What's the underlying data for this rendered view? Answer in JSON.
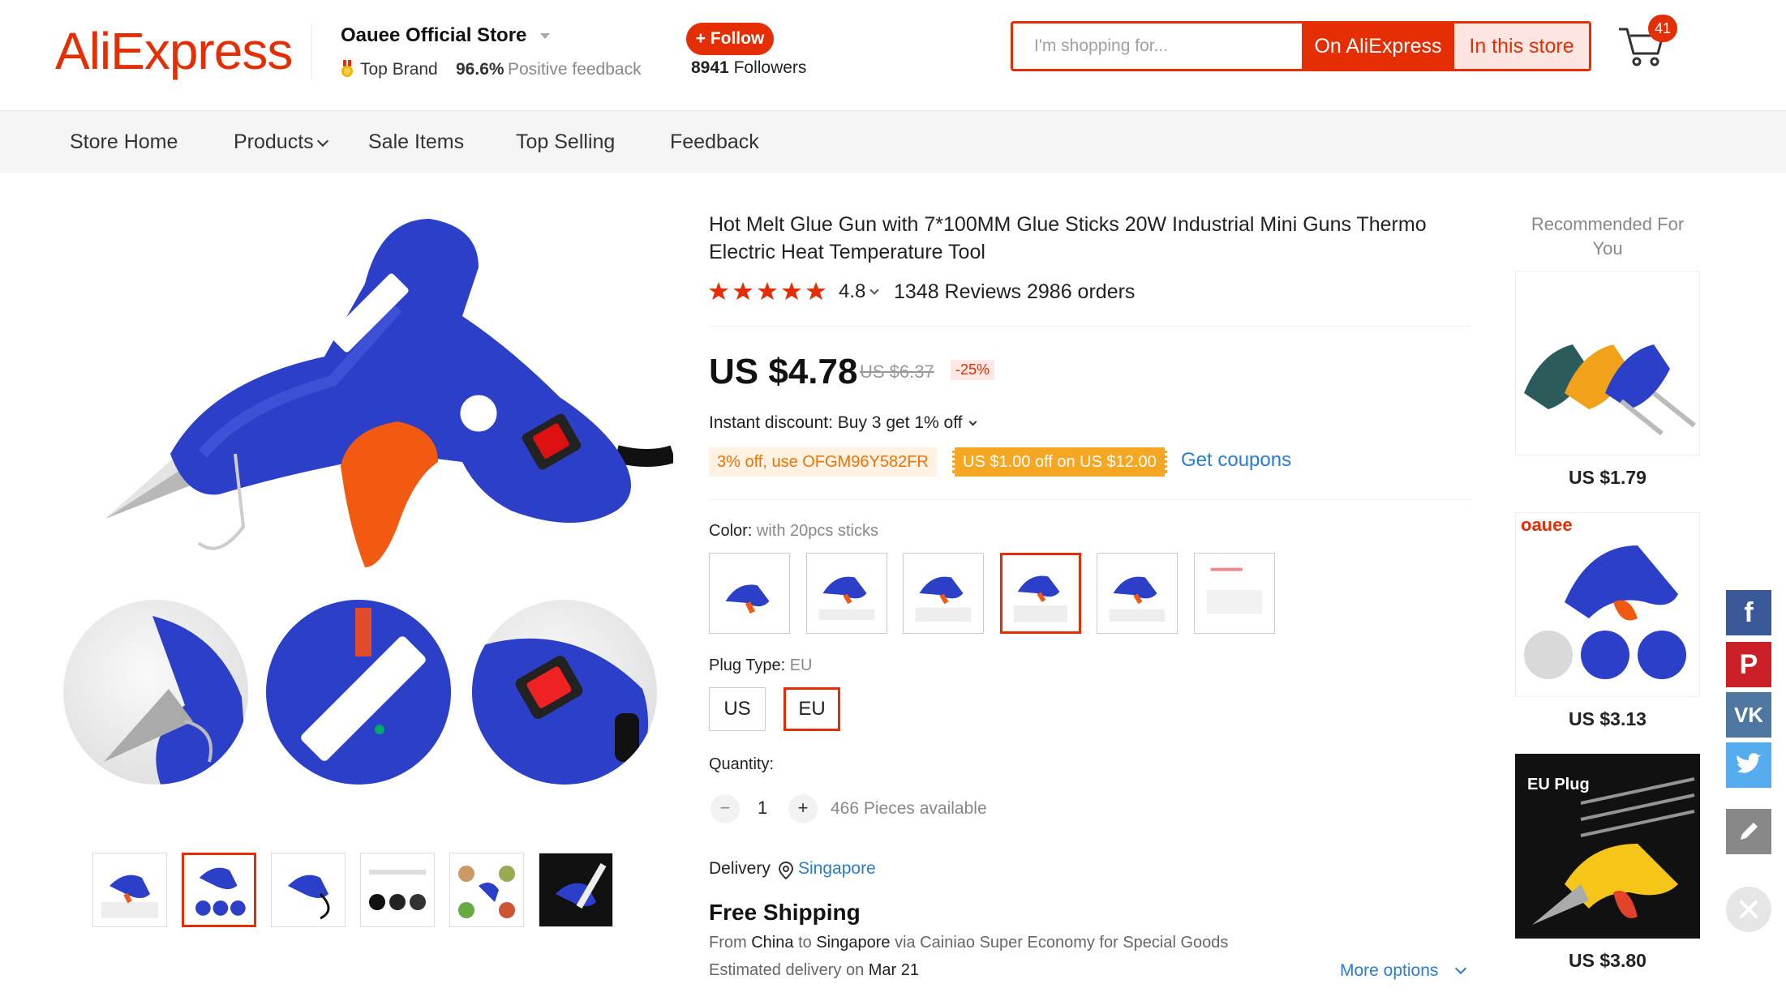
{
  "header": {
    "logo_text": "AliExpress",
    "store_name": "Oauee Official Store",
    "top_brand": "Top Brand",
    "positive_pct": "96.6%",
    "positive_label": "Positive feedback",
    "follow_label": "+ Follow",
    "followers_count": "8941",
    "followers_label": "Followers",
    "search_placeholder": "I'm shopping for...",
    "btn_on_aliexpress": "On AliExpress",
    "btn_in_store": "In this store",
    "cart_count": "41"
  },
  "nav": {
    "items": [
      "Store Home",
      "Products",
      "Sale Items",
      "Top Selling",
      "Feedback"
    ]
  },
  "product": {
    "title": "Hot Melt Glue Gun with 7*100MM Glue Sticks 20W Industrial Mini Guns Thermo Electric Heat Temperature Tool",
    "rating": "4.8",
    "reviews": "1348 Reviews",
    "orders": "2986 orders",
    "price": "US $4.78",
    "old_price": "US $6.37",
    "discount": "-25%",
    "instant_discount_label": "Instant discount:",
    "instant_discount_value": "Buy 3 get 1% off",
    "coupon_code": "3% off, use OFGM96Y582FR",
    "coupon_store": "US $1.00 off on US $12.00",
    "get_coupons": "Get coupons",
    "color_label": "Color:",
    "color_value": "with 20pcs sticks",
    "plug_label": "Plug Type:",
    "plug_value": "EU",
    "plug_options": [
      "US",
      "EU"
    ],
    "quantity_label": "Quantity:",
    "quantity": "1",
    "available": "466 Pieces available",
    "delivery_label": "Delivery",
    "delivery_location": "Singapore",
    "free_shipping": "Free Shipping",
    "ship_from_label": "From",
    "ship_from": "China",
    "ship_to_label": "to",
    "ship_to": "Singapore",
    "ship_via": "via Cainiao Super Economy for Special Goods",
    "eta_label": "Estimated delivery on",
    "eta_date": "Mar 21",
    "more_options": "More options"
  },
  "recommended": {
    "title": "Recommended For You",
    "items": [
      {
        "price": "US $1.79"
      },
      {
        "price": "US $3.13",
        "brand": "oauee"
      },
      {
        "price": "US $3.80",
        "tag": "EU Plug"
      }
    ]
  },
  "colors": {
    "accent": "#e62e04",
    "link": "#2a7bd1",
    "coupon_orange": "#f5a623",
    "star": "#e62e04"
  }
}
